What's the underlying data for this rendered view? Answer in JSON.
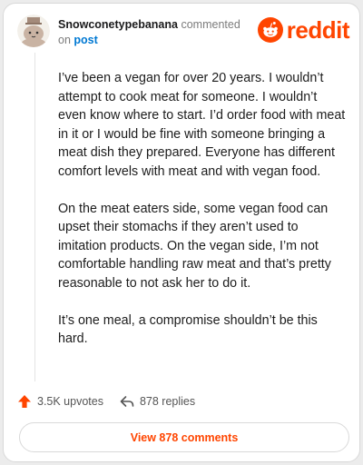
{
  "comment": {
    "username": "Snowconetypebanana",
    "action_text": "commented",
    "on_text": "on",
    "post_link": "post",
    "paragraphs": [
      "I’ve been a vegan for over 20 years. I wouldn’t attempt to cook meat for someone. I wouldn’t even know where to start. I’d order food with meat in it or I would be fine with someone bringing a meat dish they prepared. Everyone has different comfort levels with meat and with vegan food.",
      "On the meat eaters side, some vegan food can upset their stomachs if they aren’t used to imitation products. On the vegan side, I’m not comfortable handling raw meat and that’s pretty reasonable to not ask her to do it.",
      "It’s one meal, a compromise shouldn’t be this hard."
    ]
  },
  "brand": {
    "name": "reddit",
    "color": "#ff4500",
    "icon": "reddit-snoo-icon"
  },
  "actions": {
    "upvotes": "3.5K upvotes",
    "replies": "878 replies",
    "upvote_icon": "upvote-arrow-icon",
    "reply_icon": "reply-arrow-icon"
  },
  "view_button": {
    "label": "View 878 comments"
  }
}
